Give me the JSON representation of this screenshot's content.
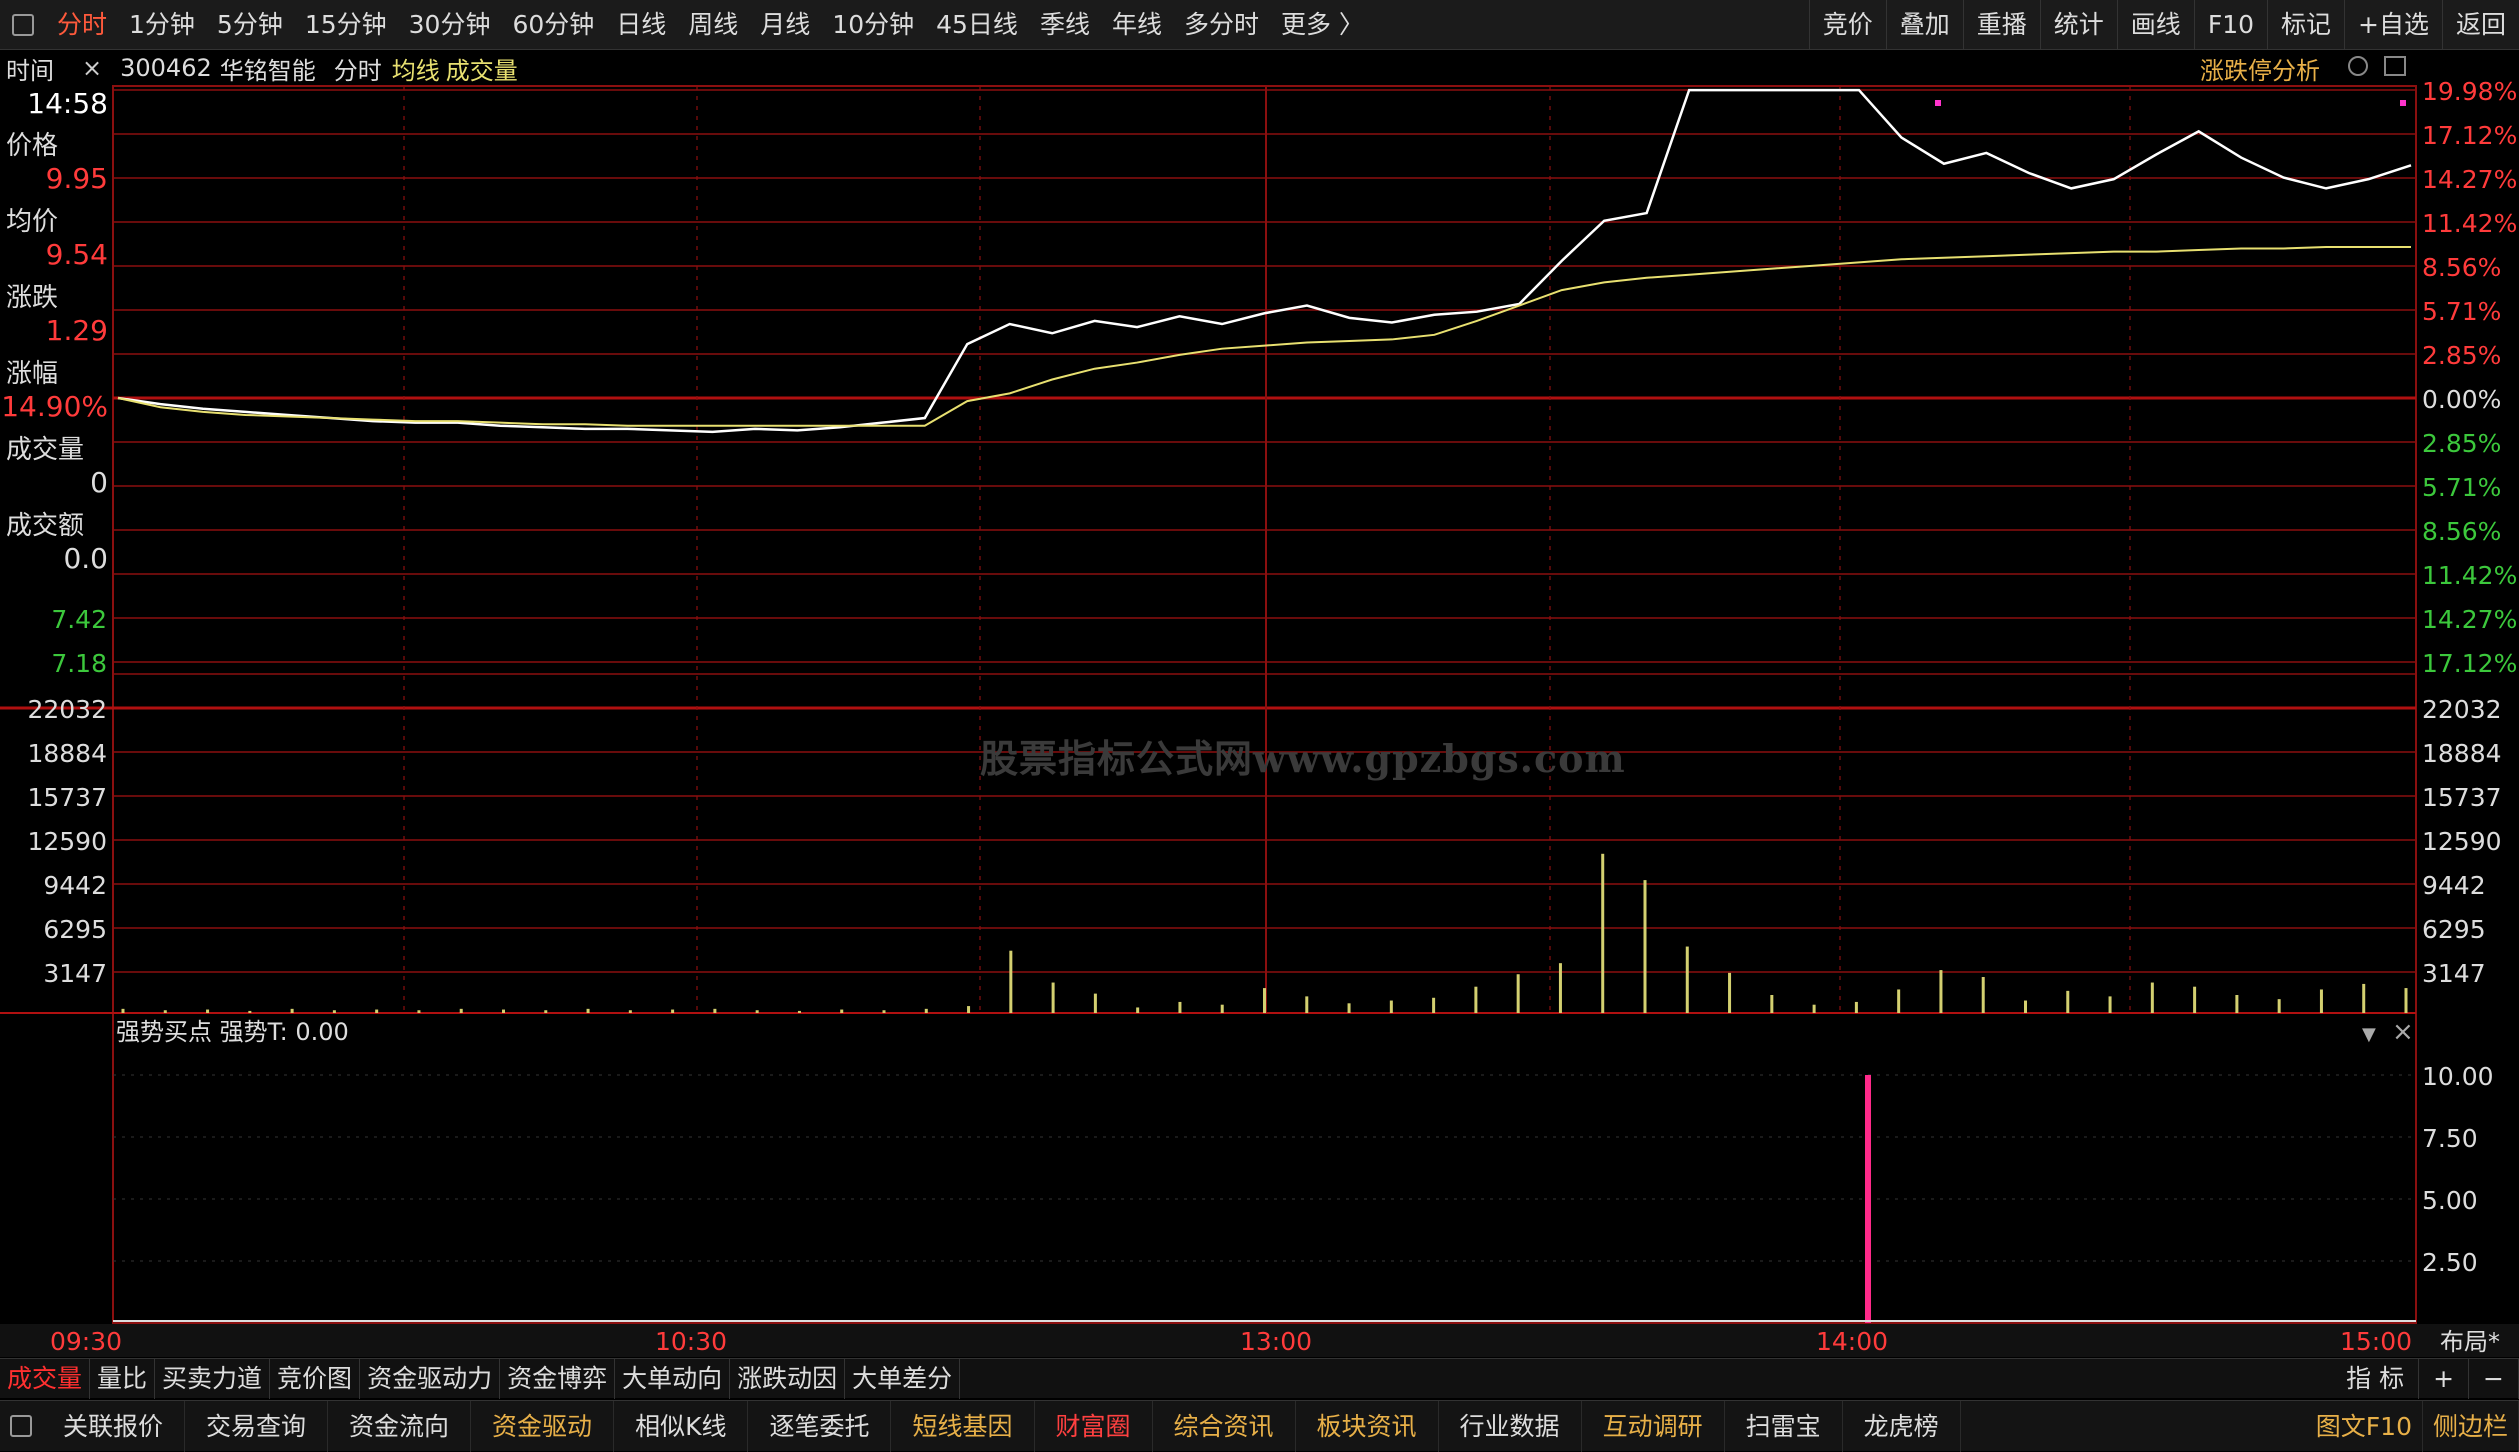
{
  "toolbar": {
    "periods": [
      "分时",
      "1分钟",
      "5分钟",
      "15分钟",
      "30分钟",
      "60分钟",
      "日线",
      "周线",
      "月线",
      "10分钟",
      "45日线",
      "季线",
      "年线",
      "多分时",
      "更多 〉"
    ],
    "right": [
      "竞价",
      "叠加",
      "重播",
      "统计",
      "画线",
      "F10",
      "标记",
      "+自选",
      "返回"
    ]
  },
  "info": {
    "time_label": "时间",
    "close_x": "×",
    "code": "300462",
    "name": "华铭智能",
    "mode": "分时",
    "avg_line": "均线",
    "volume": "成交量",
    "analysis": "涨跌停分析"
  },
  "left_panel": {
    "time": "14:58",
    "price_label": "价格",
    "price": "9.95",
    "avg_label": "均价",
    "avg": "9.54",
    "change_label": "涨跌",
    "change": "1.29",
    "pct_label": "涨幅",
    "pct": "14.90%",
    "vol_label": "成交量",
    "vol": "0",
    "amount_label": "成交额",
    "amount": "0.0"
  },
  "colors": {
    "up": "#ff3b3b",
    "down": "#3cc83c",
    "grid": "#8b0f0f",
    "price_line": "#ffffff",
    "avg_line": "#e8e070",
    "volume_bar": "#d4d070",
    "signal": "#ff2a8a"
  },
  "chart_data": {
    "type": "line",
    "price_axis_left": [
      "9.95",
      "9.54",
      "7.42",
      "7.18"
    ],
    "pct_axis_right": [
      "19.98%",
      "17.12%",
      "14.27%",
      "11.42%",
      "8.56%",
      "5.71%",
      "2.85%",
      "0.00%",
      "2.85%",
      "5.71%",
      "8.56%",
      "11.42%",
      "14.27%",
      "17.12%"
    ],
    "time_ticks": [
      "09:30",
      "10:30",
      "13:00",
      "14:00",
      "15:00"
    ],
    "series": [
      {
        "values_pct": [
          0.0,
          -0.4,
          -0.7,
          -0.9,
          -1.1,
          -1.3,
          -1.5,
          -1.6,
          -1.6,
          -1.8,
          -1.9,
          -2.0,
          -2.0,
          -2.1,
          -2.2,
          -2.0,
          -2.1,
          -1.9,
          -1.6,
          -1.3,
          3.5,
          4.8,
          4.2,
          5.0,
          4.6,
          5.3,
          4.8,
          5.5,
          6.0,
          5.2,
          4.9,
          5.4,
          5.6,
          6.1,
          8.9,
          11.5,
          12.0,
          19.98,
          19.98,
          19.98,
          19.98,
          19.98,
          16.9,
          15.2,
          15.9,
          14.6,
          13.6,
          14.2,
          15.8,
          17.3,
          15.6,
          14.3,
          13.6,
          14.2,
          15.1
        ]
      },
      {
        "values_pct": [
          0.0,
          -0.6,
          -0.9,
          -1.1,
          -1.2,
          -1.3,
          -1.4,
          -1.5,
          -1.5,
          -1.6,
          -1.7,
          -1.7,
          -1.8,
          -1.8,
          -1.8,
          -1.8,
          -1.8,
          -1.8,
          -1.8,
          -1.8,
          -0.2,
          0.3,
          1.2,
          1.9,
          2.3,
          2.8,
          3.2,
          3.4,
          3.6,
          3.7,
          3.8,
          4.1,
          5.0,
          6.0,
          7.0,
          7.5,
          7.8,
          8.0,
          8.2,
          8.4,
          8.6,
          8.8,
          9.0,
          9.1,
          9.2,
          9.3,
          9.4,
          9.5,
          9.5,
          9.6,
          9.7,
          9.7,
          9.8,
          9.8,
          9.8
        ]
      }
    ],
    "volume_axis": [
      "22032",
      "18884",
      "15737",
      "12590",
      "9442",
      "6295",
      "3147"
    ],
    "volume": [
      300,
      200,
      250,
      150,
      300,
      200,
      250,
      200,
      300,
      250,
      200,
      300,
      200,
      250,
      300,
      200,
      150,
      250,
      200,
      300,
      500,
      4500,
      2200,
      1400,
      400,
      800,
      600,
      1800,
      1200,
      700,
      900,
      1100,
      1900,
      2800,
      3600,
      11500,
      9600,
      4800,
      2900,
      1300,
      600,
      800,
      1700,
      3100,
      2600,
      900,
      1600,
      1200,
      2200,
      1900,
      1300,
      1000,
      1700,
      2100,
      1800
    ],
    "indicator": {
      "name": "强势买点",
      "label": "强势T: 0.00",
      "axis": [
        "10.00",
        "7.50",
        "5.00",
        "2.50"
      ],
      "signal_value": 10.0,
      "signal_time": "13:58"
    }
  },
  "bottom_tabs": [
    "成交量",
    "量比",
    "买卖力道",
    "竞价图",
    "资金驱动力",
    "资金博弈",
    "大单动向",
    "涨跌动因",
    "大单差分"
  ],
  "bottom_tabs_right": [
    "指 标",
    "+",
    "−"
  ],
  "layout_label": "布局*",
  "bottom_bar": [
    {
      "label": "关联报价",
      "color": "#dddddd"
    },
    {
      "label": "交易查询",
      "color": "#dddddd"
    },
    {
      "label": "资金流向",
      "color": "#dddddd"
    },
    {
      "label": "资金驱动",
      "color": "#e8b048"
    },
    {
      "label": "相似K线",
      "color": "#dddddd"
    },
    {
      "label": "逐笔委托",
      "color": "#dddddd"
    },
    {
      "label": "短线基因",
      "color": "#e8b048"
    },
    {
      "label": "财富圈",
      "color": "#ff4040"
    },
    {
      "label": "综合资讯",
      "color": "#e8b048"
    },
    {
      "label": "板块资讯",
      "color": "#e8b048"
    },
    {
      "label": "行业数据",
      "color": "#dddddd"
    },
    {
      "label": "互动调研",
      "color": "#e8b048"
    },
    {
      "label": "扫雷宝",
      "color": "#dddddd"
    },
    {
      "label": "龙虎榜",
      "color": "#dddddd"
    }
  ],
  "bottom_right": [
    "图文F10",
    "侧边栏"
  ],
  "watermark": "股票指标公式网www.gpzbgs.com"
}
